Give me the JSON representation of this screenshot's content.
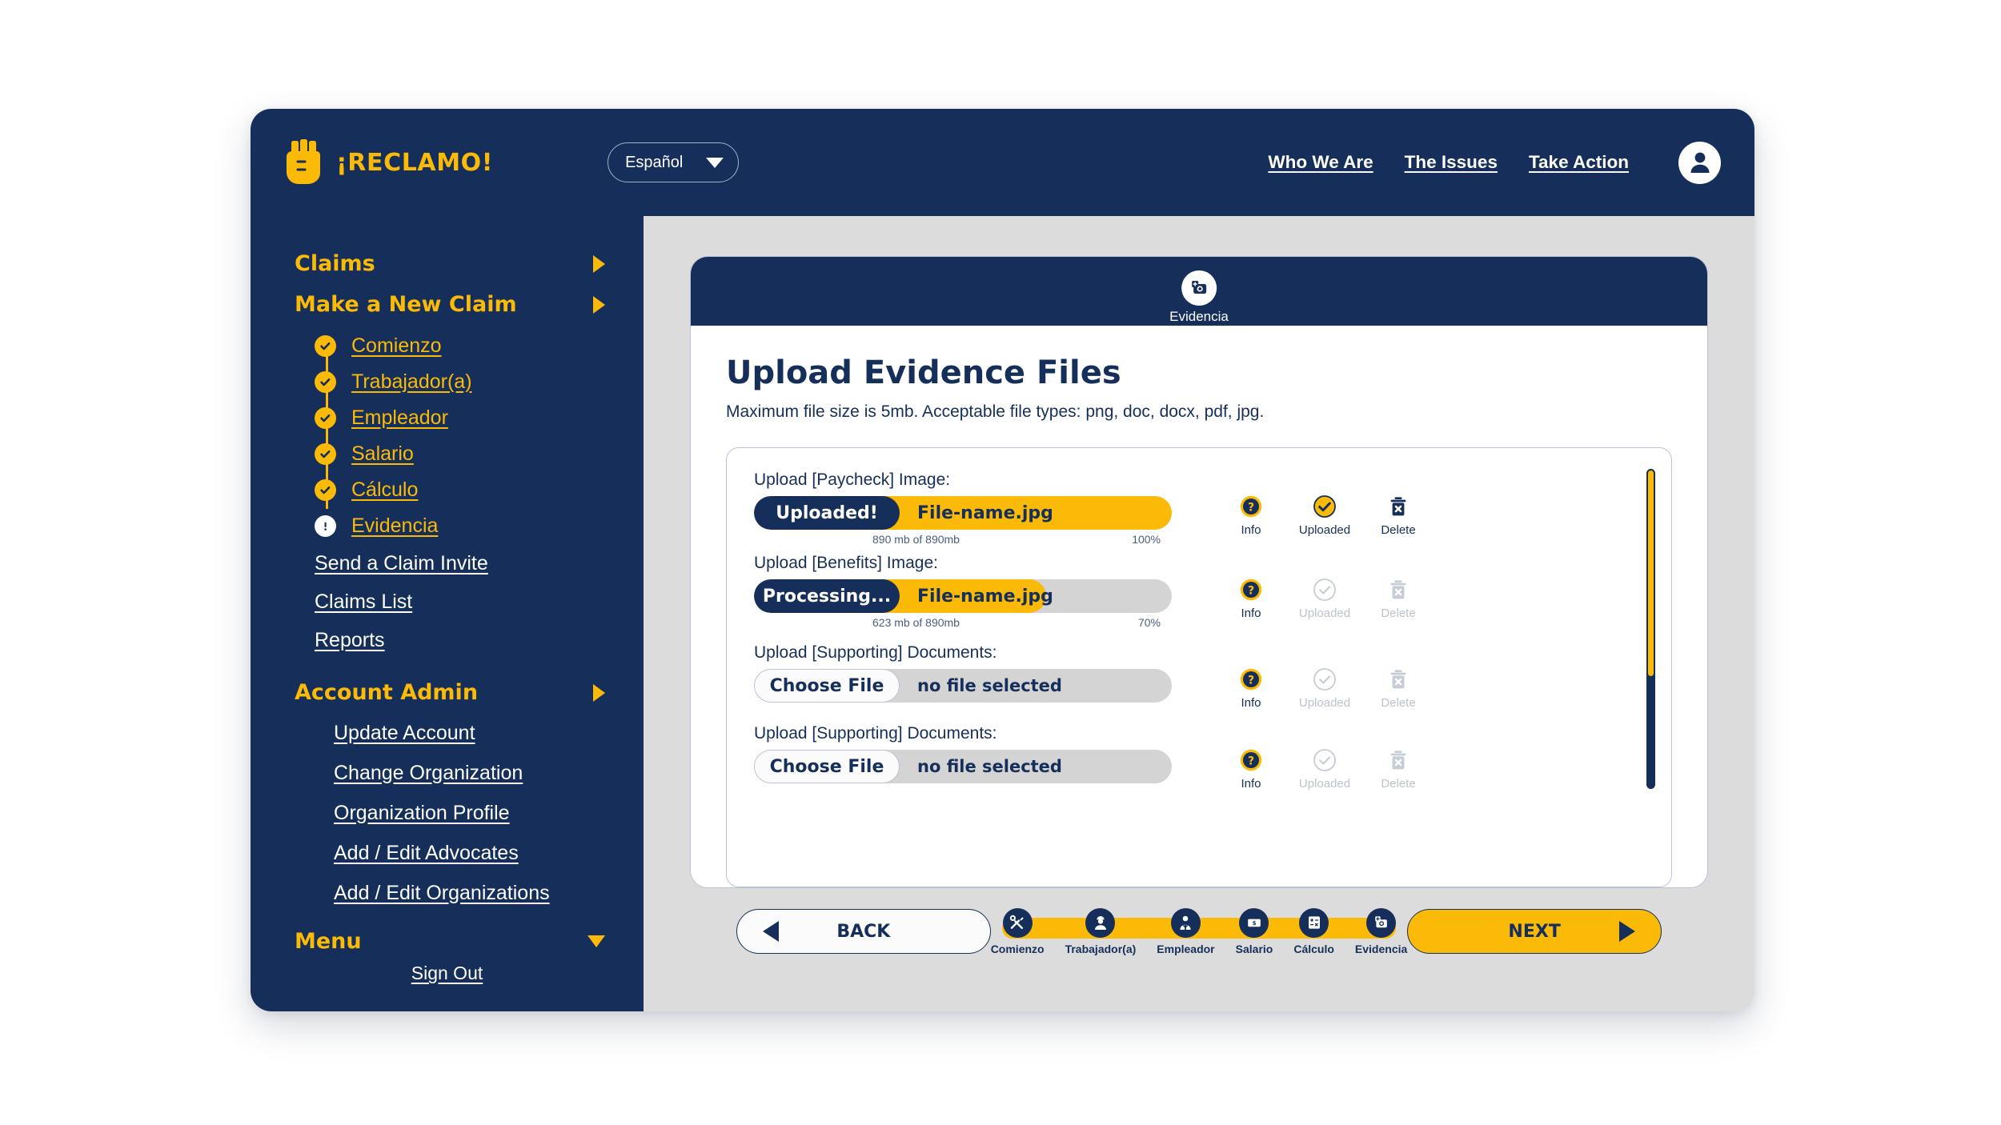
{
  "brand": {
    "name": "¡RECLAMO!",
    "logo_icon": "raised-fist-icon"
  },
  "topbar": {
    "language": {
      "selected": "Español",
      "caret_icon": "chevron-down-icon"
    },
    "nav_links": [
      {
        "label": "Who We Are"
      },
      {
        "label": "The Issues"
      },
      {
        "label": "Take Action"
      }
    ],
    "avatar_icon": "user-account-icon"
  },
  "sidebar": {
    "groups": [
      {
        "label": "Claims",
        "caret": "caret-right-icon"
      },
      {
        "label": "Make a New Claim",
        "caret": "caret-right-icon"
      }
    ],
    "steps": [
      {
        "label": "Comienzo",
        "state": "done",
        "icon": "check-circle-icon"
      },
      {
        "label": "Trabajador(a)",
        "state": "done",
        "icon": "check-circle-icon"
      },
      {
        "label": "Empleador",
        "state": "done",
        "icon": "check-circle-icon"
      },
      {
        "label": "Salario",
        "state": "done",
        "icon": "check-circle-icon"
      },
      {
        "label": "Cálculo",
        "state": "done",
        "icon": "check-circle-icon"
      },
      {
        "label": "Evidencia",
        "state": "alert",
        "icon": "exclamation-circle-icon"
      }
    ],
    "claim_links": [
      {
        "label": "Send a Claim Invite"
      },
      {
        "label": "Claims List"
      },
      {
        "label": "Reports"
      }
    ],
    "account_admin": {
      "label": "Account Admin",
      "caret": "caret-right-icon"
    },
    "admin_links": [
      {
        "label": "Update Account"
      },
      {
        "label": "Change Organization"
      },
      {
        "label": "Organization Profile"
      },
      {
        "label": "Add / Edit Advocates"
      },
      {
        "label": "Add / Edit Organizations"
      }
    ],
    "menu": {
      "label": "Menu",
      "caret": "caret-down-icon"
    },
    "sign_out": "Sign Out"
  },
  "card": {
    "header": {
      "icon": "add-photo-icon",
      "caption": "Evidencia"
    },
    "title": "Upload Evidence Files",
    "subtitle": "Maximum file size is 5mb. Acceptable file types: png, doc, docx, pdf, jpg."
  },
  "uploads": {
    "rows": [
      {
        "label": "Upload [Paycheck] Image:",
        "type": "progress",
        "status": "Uploaded!",
        "filename": "File-name.jpg",
        "size_text": "890 mb of 890mb",
        "percent_text": "100%",
        "percent": 100,
        "actions": {
          "info": {
            "label": "Info",
            "enabled": true,
            "icon": "question-circle-icon"
          },
          "uploaded": {
            "label": "Uploaded",
            "enabled": true,
            "icon": "check-circle-icon"
          },
          "delete": {
            "label": "Delete",
            "enabled": true,
            "icon": "trash-icon"
          }
        }
      },
      {
        "label": "Upload [Benefits] Image:",
        "type": "progress",
        "status": "Processing...",
        "filename": "File-name.jpg",
        "size_text": "623 mb of 890mb",
        "percent_text": "70%",
        "percent": 70,
        "actions": {
          "info": {
            "label": "Info",
            "enabled": true,
            "icon": "question-circle-icon"
          },
          "uploaded": {
            "label": "Uploaded",
            "enabled": false,
            "icon": "check-circle-icon"
          },
          "delete": {
            "label": "Delete",
            "enabled": false,
            "icon": "trash-icon"
          }
        }
      },
      {
        "label": "Upload [Supporting] Documents:",
        "type": "file",
        "button": "Choose File",
        "filename": "no file selected",
        "actions": {
          "info": {
            "label": "Info",
            "enabled": true,
            "icon": "question-circle-icon"
          },
          "uploaded": {
            "label": "Uploaded",
            "enabled": false,
            "icon": "check-circle-icon"
          },
          "delete": {
            "label": "Delete",
            "enabled": false,
            "icon": "trash-icon"
          }
        }
      },
      {
        "label": "Upload [Supporting] Documents:",
        "type": "file",
        "button": "Choose File",
        "filename": "no file selected",
        "actions": {
          "info": {
            "label": "Info",
            "enabled": true,
            "icon": "question-circle-icon"
          },
          "uploaded": {
            "label": "Uploaded",
            "enabled": false,
            "icon": "check-circle-icon"
          },
          "delete": {
            "label": "Delete",
            "enabled": false,
            "icon": "trash-icon"
          }
        }
      }
    ],
    "scrollbar": {
      "thumb_percent": 65
    }
  },
  "footer": {
    "back": {
      "label": "BACK",
      "icon": "triangle-left-icon"
    },
    "next": {
      "label": "NEXT",
      "icon": "triangle-right-icon"
    },
    "stepper": [
      {
        "label": "Comienzo",
        "icon": "tools-icon"
      },
      {
        "label": "Trabajador(a)",
        "icon": "worker-icon"
      },
      {
        "label": "Empleador",
        "icon": "employer-icon"
      },
      {
        "label": "Salario",
        "icon": "money-bill-icon"
      },
      {
        "label": "Cálculo",
        "icon": "calculator-icon"
      },
      {
        "label": "Evidencia",
        "icon": "camera-icon"
      }
    ]
  },
  "colors": {
    "navy": "#152f5a",
    "yellow": "#fbba07",
    "content_bg": "#dcdcdc",
    "control_gray": "#d4d4d4",
    "disabled_gray": "#c7cdd6"
  }
}
